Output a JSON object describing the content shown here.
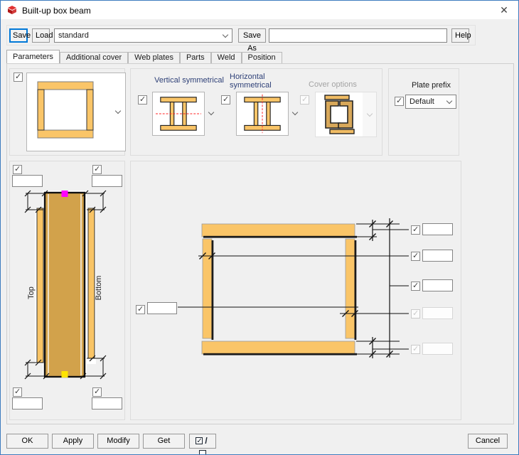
{
  "window": {
    "title": "Built-up box beam",
    "close_glyph": "✕"
  },
  "toolbar": {
    "save": "Save",
    "load": "Load",
    "profile_value": "standard",
    "save_as": "Save As",
    "name_value": "",
    "help": "Help"
  },
  "tabs": {
    "items": [
      "Parameters",
      "Additional cover",
      "Web plates",
      "Parts",
      "Weld",
      "Position"
    ],
    "active": "Parameters"
  },
  "options": {
    "main_preview": {
      "checked": true
    },
    "vertical_symmetrical": {
      "label": "Vertical symmetrical",
      "checked": true,
      "enabled": true
    },
    "horizontal_symmetrical": {
      "label": "Horizontal symmetrical",
      "checked": true,
      "enabled": true
    },
    "cover_options": {
      "label": "Cover options",
      "checked": true,
      "enabled": false
    },
    "plate_prefix": {
      "label": "Plate prefix",
      "checked": true,
      "value": "Default"
    }
  },
  "elevation": {
    "top_label": "Top",
    "bottom_label": "Bottom",
    "fields": [
      {
        "pos": "top-left",
        "checked": true,
        "value": ""
      },
      {
        "pos": "top-right",
        "checked": true,
        "value": ""
      },
      {
        "pos": "bottom-left",
        "checked": true,
        "value": ""
      },
      {
        "pos": "bottom-right",
        "checked": true,
        "value": ""
      }
    ]
  },
  "cross_section": {
    "left_field": {
      "checked": true,
      "value": ""
    },
    "rows": [
      {
        "checked": true,
        "enabled": true,
        "value": ""
      },
      {
        "checked": true,
        "enabled": true,
        "value": ""
      },
      {
        "checked": true,
        "enabled": true,
        "value": ""
      },
      {
        "checked": true,
        "enabled": false,
        "value": ""
      },
      {
        "checked": true,
        "enabled": false,
        "value": ""
      }
    ]
  },
  "footer": {
    "ok": "OK",
    "apply": "Apply",
    "modify": "Modify",
    "get": "Get",
    "toggle_separator": "/",
    "cancel": "Cancel"
  },
  "colors": {
    "plate_fill": "#FAC568",
    "plate_dark_fill": "#D2A24B",
    "handle_top": "#FF00FF",
    "handle_bottom": "#FFE500",
    "symmetry_line": "#FF2020",
    "accent_blue": "#0078D7",
    "window_border": "#3E7CBF"
  }
}
